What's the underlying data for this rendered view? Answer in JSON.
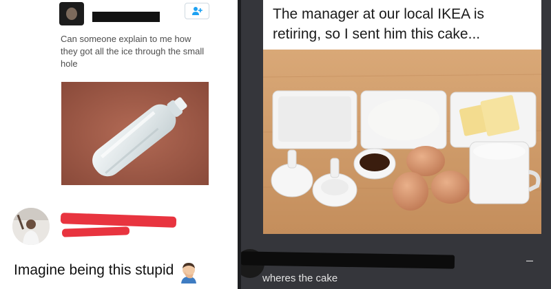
{
  "tweet": {
    "text": "Can someone explain to me how they got all the ice through the small hole",
    "follow_icon": "person-plus-icon",
    "photo": "frozen-water-bottle-photo"
  },
  "reply": {
    "text": "Imagine being this stupid",
    "emoji": "man-facepalming-emoji"
  },
  "meme": {
    "caption": "The manager at our local IKEA is retiring, so I sent him this cake...",
    "photo": "cake-ingredients-photo"
  },
  "comment": {
    "text": "wheres the cake",
    "menu_glyph": "–"
  },
  "colors": {
    "redaction_red": "#e8343f",
    "dark_background": "#35363b",
    "tweet_text": "#4d4d4d"
  }
}
